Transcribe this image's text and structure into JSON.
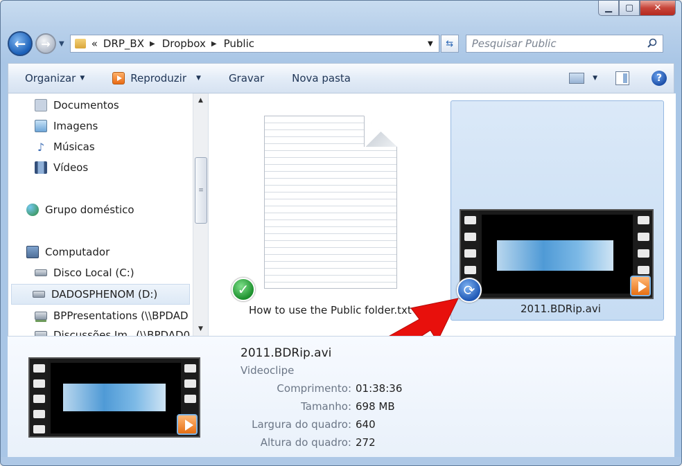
{
  "window": {
    "minimize": "▁",
    "maximize": "▢",
    "close": "✕"
  },
  "nav": {
    "path": [
      "DRP_BX",
      "Dropbox",
      "Public"
    ],
    "path_prefix": "«",
    "search_placeholder": "Pesquisar Public"
  },
  "toolbar": {
    "organize": "Organizar",
    "play": "Reproduzir",
    "burn": "Gravar",
    "new_folder": "Nova pasta",
    "help": "?"
  },
  "sidebar": {
    "items": [
      {
        "label": "Documentos",
        "icon": "documents-icon",
        "color": "#c8d3e2"
      },
      {
        "label": "Imagens",
        "icon": "pictures-icon",
        "color": "#6fa6d8"
      },
      {
        "label": "Músicas",
        "icon": "music-icon",
        "color": "#3d6db5"
      },
      {
        "label": "Vídeos",
        "icon": "videos-icon",
        "color": "#334f7a"
      },
      {
        "label": "Grupo doméstico",
        "icon": "homegroup-icon",
        "color": "#2f8c3c"
      },
      {
        "label": "Computador",
        "icon": "computer-icon",
        "color": "#4f6f98"
      },
      {
        "label": "Disco Local (C:)",
        "icon": "drive-icon",
        "color": "#8c99a8"
      },
      {
        "label": "DADOSPHENOM (D:)",
        "icon": "drive-icon",
        "color": "#8c99a8"
      },
      {
        "label": "BPPresentations (\\\\BPDAD",
        "icon": "network-drive-icon",
        "color": "#6e9b5c"
      },
      {
        "label": "Discussões Im_ (\\\\BPDAD0",
        "icon": "network-drive-icon",
        "color": "#6e9b5c"
      }
    ]
  },
  "files": {
    "txt_name": "How to use the Public folder.txt",
    "video_name": "2011.BDRip.avi"
  },
  "details": {
    "name": "2011.BDRip.avi",
    "type": "Videoclipe",
    "props": [
      {
        "key": "Comprimento:",
        "value": "01:38:36"
      },
      {
        "key": "Tamanho:",
        "value": "698 MB"
      },
      {
        "key": "Largura do quadro:",
        "value": "640"
      },
      {
        "key": "Altura do quadro:",
        "value": "272"
      }
    ]
  },
  "colors": {
    "selection": "#c6dcf3",
    "arrow": "#e8100c",
    "sync_blue": "#1f58b5",
    "check_green": "#1b8f2c"
  }
}
